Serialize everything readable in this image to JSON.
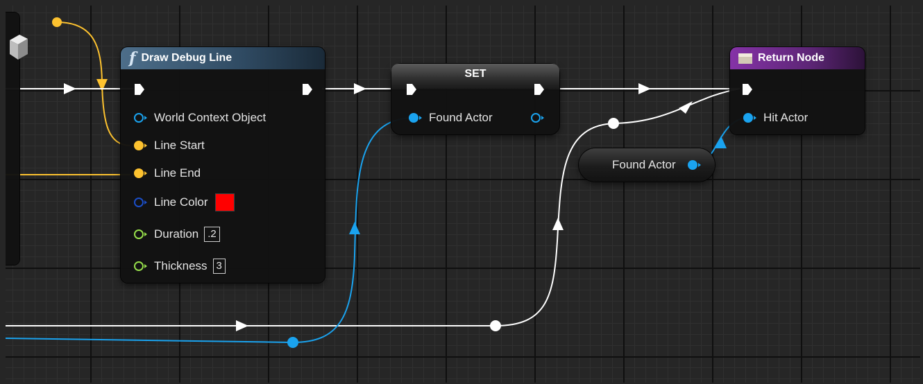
{
  "colors": {
    "exec_wire": "#ffffff",
    "vector_pin": "#fdc22f",
    "object_pin": "#1aa3ef",
    "struct_pin": "#1b4ec9",
    "float_pin": "#98e04c",
    "line_color_value": "#ff0000",
    "function_header": "#4d6e8a",
    "return_header": "#8533a7"
  },
  "draw_debug_line": {
    "icon": "function-icon",
    "title": "Draw Debug Line",
    "pins": {
      "world_context_object": "World Context Object",
      "line_start": "Line Start",
      "line_end": "Line End",
      "line_color": "Line Color",
      "duration": "Duration",
      "thickness": "Thickness"
    },
    "duration_value": ".2",
    "thickness_value": "3"
  },
  "set_node": {
    "title": "SET",
    "pin_label": "Found Actor"
  },
  "return_node": {
    "icon": "return-node-icon",
    "title": "Return Node",
    "pin_label": "Hit Actor"
  },
  "get_node": {
    "label": "Found Actor"
  }
}
